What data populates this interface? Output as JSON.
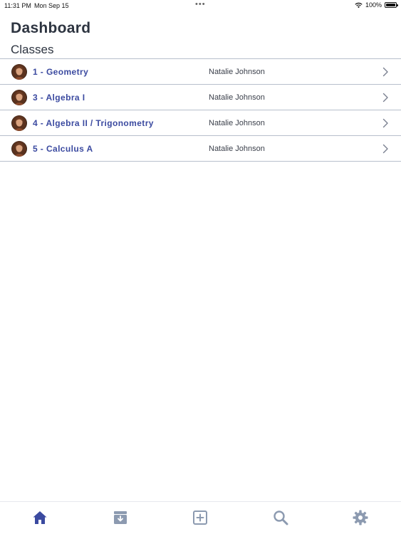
{
  "status_bar": {
    "time": "11:31 PM",
    "date": "Mon Sep 15",
    "dots": "•••",
    "battery": "100%"
  },
  "header": {
    "title": "Dashboard",
    "section": "Classes"
  },
  "classes": [
    {
      "name": "1 - Geometry",
      "teacher": "Natalie Johnson"
    },
    {
      "name": "3 - Algebra I",
      "teacher": "Natalie Johnson"
    },
    {
      "name": "4 - Algebra II / Trigonometry",
      "teacher": "Natalie Johnson"
    },
    {
      "name": "5 - Calculus A",
      "teacher": "Natalie Johnson"
    }
  ],
  "tab_bar": {
    "items": [
      "home-icon",
      "inbox-icon",
      "add-icon",
      "search-icon",
      "gear-icon"
    ],
    "active": "home-icon"
  },
  "colors": {
    "accent": "#3b4aa0",
    "tab_inactive": "#8c9ab0",
    "divider": "#b7bfcc"
  }
}
